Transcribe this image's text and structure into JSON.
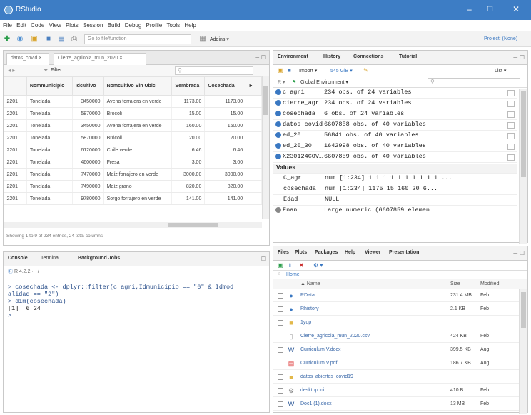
{
  "window": {
    "title": "RStudio",
    "minimize": "–",
    "maximize": "☐",
    "close": "✕"
  },
  "menu": [
    "File",
    "Edit",
    "Code",
    "View",
    "Plots",
    "Session",
    "Build",
    "Debug",
    "Profile",
    "Tools",
    "Help"
  ],
  "toolbar": {
    "goto_placeholder": "Go to file/function",
    "addins": "Addins ▾",
    "project": "Project: (None)"
  },
  "source": {
    "tabs": [
      "datos_covid",
      "Cierre_agricola_mun_2020"
    ],
    "filter_label": "Filter",
    "columns": [
      "",
      "Nommunicipio",
      "Idcultivo",
      "Nomcultivo Sin Ubic",
      "Sembrada",
      "Cosechada",
      "F"
    ],
    "rows": [
      [
        "2201",
        "Tonelada",
        "3450000",
        "Avena forrajera en verde",
        "1173.00",
        "1173.00"
      ],
      [
        "2201",
        "Tonelada",
        "5870000",
        "Brócoli",
        "15.00",
        "15.00"
      ],
      [
        "2201",
        "Tonelada",
        "3450000",
        "Avena forrajera en verde",
        "160.00",
        "160.00"
      ],
      [
        "2201",
        "Tonelada",
        "5870000",
        "Brócoli",
        "20.00",
        "20.00"
      ],
      [
        "2201",
        "Tonelada",
        "6120000",
        "Chile verde",
        "6.46",
        "6.46"
      ],
      [
        "2201",
        "Tonelada",
        "4600000",
        "Fresa",
        "3.00",
        "3.00"
      ],
      [
        "2201",
        "Tonelada",
        "7470000",
        "Maíz forrajero en verde",
        "3000.00",
        "3000.00"
      ],
      [
        "2201",
        "Tonelada",
        "7490000",
        "Maíz grano",
        "820.00",
        "820.00"
      ],
      [
        "2201",
        "Tonelada",
        "9780000",
        "Sorgo forrajero en verde",
        "141.00",
        "141.00"
      ]
    ],
    "status": "Showing 1 to 9 of 234 entries, 24 total columns"
  },
  "console": {
    "tabs": [
      "Console",
      "Terminal",
      "Background Jobs"
    ],
    "path": "R 4.2.2 · ~/",
    "lines": [
      "> cosechada <- dplyr::filter(c_agri,Idmunicipio == \"6\" & Idmod",
      "alidad == \"2\")",
      "> dim(cosechada)",
      "[1]  6 24",
      "> "
    ]
  },
  "environment": {
    "tabs": [
      "Environment",
      "History",
      "Connections",
      "Tutorial"
    ],
    "memory": "545 GiB ▾",
    "list_label": "List ▾",
    "scope": "Global Environment ▾",
    "data": [
      {
        "name": "c_agri",
        "value": "234 obs. of 24 variables"
      },
      {
        "name": "cierre_agr…",
        "value": "234 obs. of 24 variables"
      },
      {
        "name": "cosechada",
        "value": "6 obs. of 24 variables"
      },
      {
        "name": "datos_covid",
        "value": "6607858 obs. of 40 variables"
      },
      {
        "name": "ed_20",
        "value": "56841 obs. of 40 variables"
      },
      {
        "name": "ed_20_30",
        "value": "1642998 obs. of 40 variables"
      },
      {
        "name": "X230124COV…",
        "value": "6607859 obs. of 40 variables"
      }
    ],
    "values_header": "Values",
    "values": [
      {
        "name": "C_agr",
        "value": "num [1:234] 1 1 1 1 1 1 1 1 1 1 ..."
      },
      {
        "name": "cosechada",
        "value": "num [1:234] 1175 15 160 20 6..."
      },
      {
        "name": "Edad",
        "value": "NULL"
      },
      {
        "name": "Enan",
        "value": "Large numeric (6607859 elemen…"
      }
    ]
  },
  "files": {
    "tabs": [
      "Files",
      "Plots",
      "Packages",
      "Help",
      "Viewer",
      "Presentation"
    ],
    "breadcrumb": "Home",
    "columns": [
      "▲ Name",
      "Size",
      "Modified"
    ],
    "rows": [
      {
        "icon": "R",
        "name": "RData",
        "size": "231.4 MB",
        "mod": "Feb"
      },
      {
        "icon": "R",
        "name": "Rhistory",
        "size": "2.1 KB",
        "mod": "Feb"
      },
      {
        "icon": "folder",
        "name": "1yup",
        "size": "",
        "mod": ""
      },
      {
        "icon": "csv",
        "name": "Cierre_agricola_mun_2020.csv",
        "size": "424 KB",
        "mod": "Feb"
      },
      {
        "icon": "word",
        "name": "Curriculum V.docx",
        "size": "399.5 KB",
        "mod": "Aug"
      },
      {
        "icon": "pdf",
        "name": "Curriculum V.pdf",
        "size": "186.7 KB",
        "mod": "Aug"
      },
      {
        "icon": "folder",
        "name": "datos_abiertos_covid19",
        "size": "",
        "mod": ""
      },
      {
        "icon": "ini",
        "name": "desktop.ini",
        "size": "410 B",
        "mod": "Feb"
      },
      {
        "icon": "word",
        "name": "Doc1 (1).docx",
        "size": "13 MB",
        "mod": "Feb"
      }
    ]
  },
  "colors": {
    "titlebar": "#3d7dc5",
    "accent": "#3a78c2"
  }
}
